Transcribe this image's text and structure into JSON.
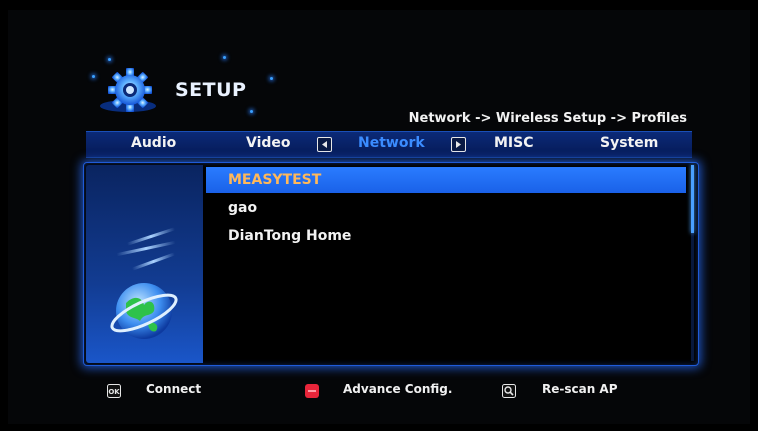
{
  "header": {
    "title": "SETUP",
    "breadcrumb": "Network -> Wireless Setup -> Profiles",
    "logo_icon": "gear-icon"
  },
  "tabs": [
    {
      "label": "Audio",
      "active": false
    },
    {
      "label": "Video",
      "active": false
    },
    {
      "label": "Network",
      "active": true
    },
    {
      "label": "MISC",
      "active": false
    },
    {
      "label": "System",
      "active": false
    }
  ],
  "profiles": {
    "items": [
      {
        "label": "MEASYTEST",
        "selected": true
      },
      {
        "label": "gao",
        "selected": false
      },
      {
        "label": "DianTong Home",
        "selected": false
      }
    ]
  },
  "footer": {
    "connect": {
      "icon": "ok-button-icon",
      "label": "Connect"
    },
    "advance": {
      "icon": "red-button-icon",
      "label": "Advance Config."
    },
    "rescan": {
      "icon": "search-icon",
      "label": "Re-scan AP"
    }
  },
  "colors": {
    "accent": "#2a7cff",
    "selected_text": "#ffb85a",
    "active_tab": "#3b8cff",
    "red_button": "#e8253a"
  }
}
